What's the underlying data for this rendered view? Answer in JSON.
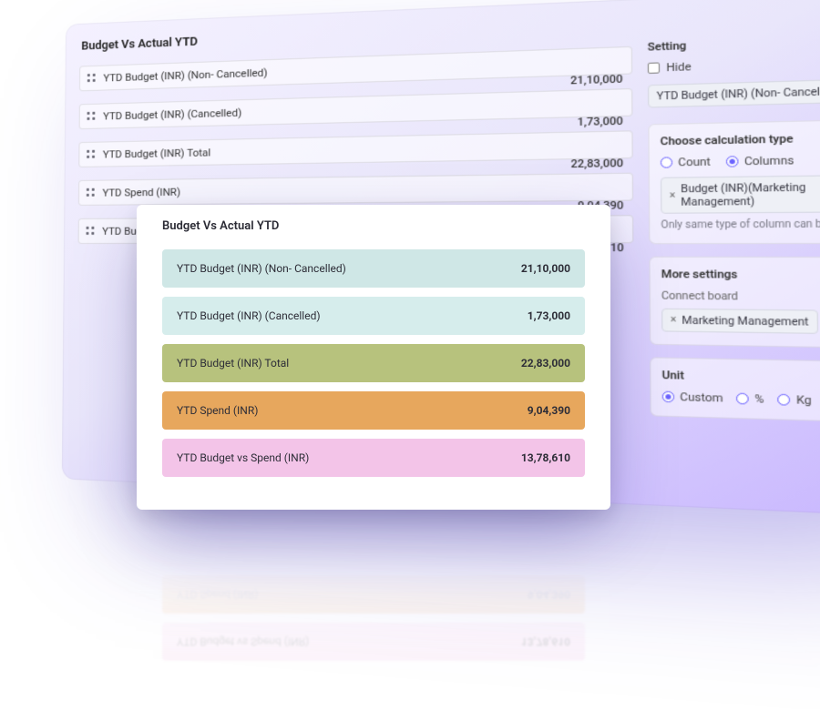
{
  "back": {
    "title": "Budget Vs Actual YTD",
    "rows": [
      {
        "label": "YTD Budget (INR) (Non- Cancelled)",
        "value": "21,10,000"
      },
      {
        "label": "YTD Budget (INR) (Cancelled)",
        "value": "1,73,000"
      },
      {
        "label": "YTD Budget (INR) Total",
        "value": "22,83,000"
      },
      {
        "label": "YTD Spend (INR)",
        "value": "9,04,390"
      },
      {
        "label": "YTD Budget vs Spend (INR)",
        "value": "13,78,610"
      }
    ]
  },
  "settings": {
    "heading": "Setting",
    "hide_label": "Hide",
    "selected_chip": "YTD Budget (INR) (Non- Cancelled)",
    "calc": {
      "heading": "Choose calculation type",
      "count": "Count",
      "columns": "Columns",
      "chip": "Budget (INR)(Marketing Management)",
      "note": "Only same type of column can be selec"
    },
    "more": {
      "heading": "More settings",
      "sub": "Connect board",
      "chip": "Marketing Management"
    },
    "unit": {
      "heading": "Unit",
      "custom": "Custom",
      "percent": "%",
      "kg": "Kg",
      "dollar": "$"
    }
  },
  "front": {
    "title": "Budget Vs Actual YTD",
    "rows": [
      {
        "label": "YTD Budget (INR) (Non- Cancelled)",
        "value": "21,10,000",
        "cls": "c-teal"
      },
      {
        "label": "YTD Budget (INR) (Cancelled)",
        "value": "1,73,000",
        "cls": "c-teal2"
      },
      {
        "label": "YTD Budget (INR) Total",
        "value": "22,83,000",
        "cls": "c-olive"
      },
      {
        "label": "YTD Spend (INR)",
        "value": "9,04,390",
        "cls": "c-orange"
      },
      {
        "label": "YTD Budget vs Spend (INR)",
        "value": "13,78,610",
        "cls": "c-pink"
      }
    ]
  }
}
